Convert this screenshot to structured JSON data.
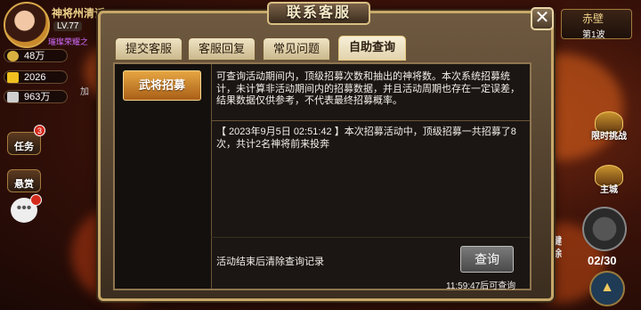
{
  "player": {
    "name": "神将州清话",
    "level": "LV.77",
    "subtitle": "璀璨荣耀之",
    "resources": [
      {
        "icon": "power-icon",
        "value": "48万"
      },
      {
        "icon": "gold-icon",
        "value": "2026"
      },
      {
        "icon": "silver-icon",
        "value": "963万"
      }
    ]
  },
  "left_menu": {
    "task_label": "任务",
    "task_badge": "3",
    "bounty_label": "悬赏",
    "chat_badge": "",
    "plus_label": "加"
  },
  "right_hud": {
    "stage_name": "赤壁",
    "stage_wave": "第1波",
    "limited_challenge": "限时挑战",
    "main_city": "主城",
    "counter": "02/30",
    "side_text_1": "键",
    "side_text_2": "除"
  },
  "dialog": {
    "title": "联系客服",
    "tabs": [
      {
        "label": "提交客服",
        "active": false
      },
      {
        "label": "客服回复",
        "active": false
      },
      {
        "label": "常见问题",
        "active": false
      },
      {
        "label": "自助查询",
        "active": true
      }
    ],
    "sidebar_button": "武将招募",
    "description": "可查询活动期间内，顶级招募次数和抽出的神将数。本次系统招募统计，未计算非活动期间内的招募数据，并且活动周期也存在一定误差，结果数据仅供参考，不代表最终招募概率。",
    "result": "【 2023年9月5日 02:51:42 】本次招募活动中，顶级招募一共招募了8次，共计2名神将前来投奔",
    "footer_note": "活动结束后清除查询记录",
    "query_button": "查询",
    "cooldown": "11:59:47后可查询"
  },
  "colors": {
    "accent": "#c7a86a",
    "button_orange": "#e6a642",
    "panel_bg": "#1b1613"
  }
}
